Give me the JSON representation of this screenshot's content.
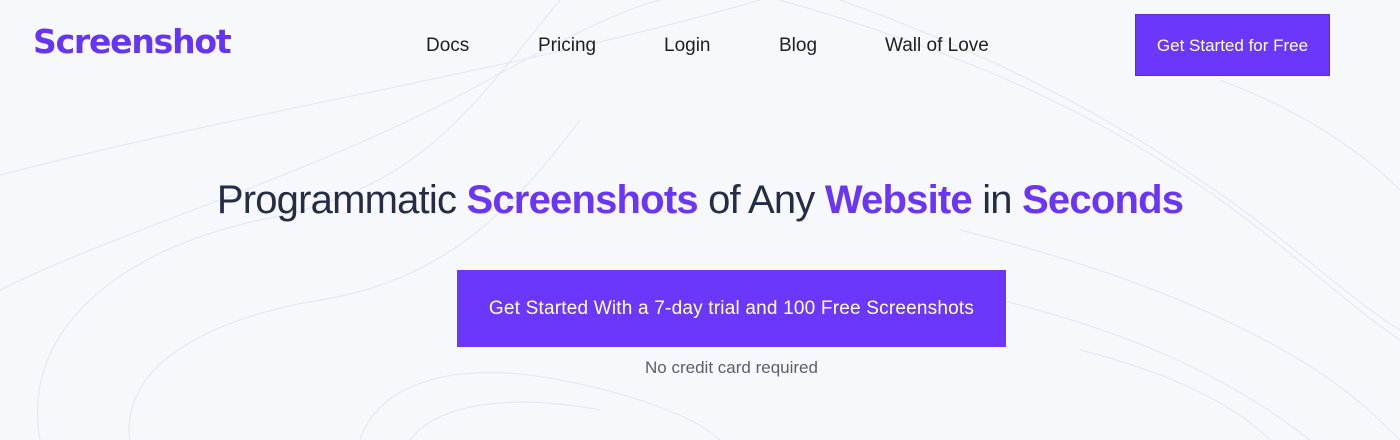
{
  "brand": {
    "logo_text": "Screenshot",
    "accent_color": "#6b38fb"
  },
  "nav": {
    "items": [
      {
        "label": "Docs"
      },
      {
        "label": "Pricing"
      },
      {
        "label": "Login"
      },
      {
        "label": "Blog"
      },
      {
        "label": "Wall of Love"
      }
    ],
    "cta_label": "Get Started for Free"
  },
  "hero": {
    "headline": [
      {
        "text": "Programmatic ",
        "highlight": false
      },
      {
        "text": "Screenshots",
        "highlight": true
      },
      {
        "text": " of Any ",
        "highlight": false
      },
      {
        "text": "Website",
        "highlight": true
      },
      {
        "text": " in ",
        "highlight": false
      },
      {
        "text": "Seconds",
        "highlight": true
      }
    ],
    "cta_label": "Get Started With a 7-day trial and 100 Free Screenshots",
    "note": "No credit card required"
  }
}
